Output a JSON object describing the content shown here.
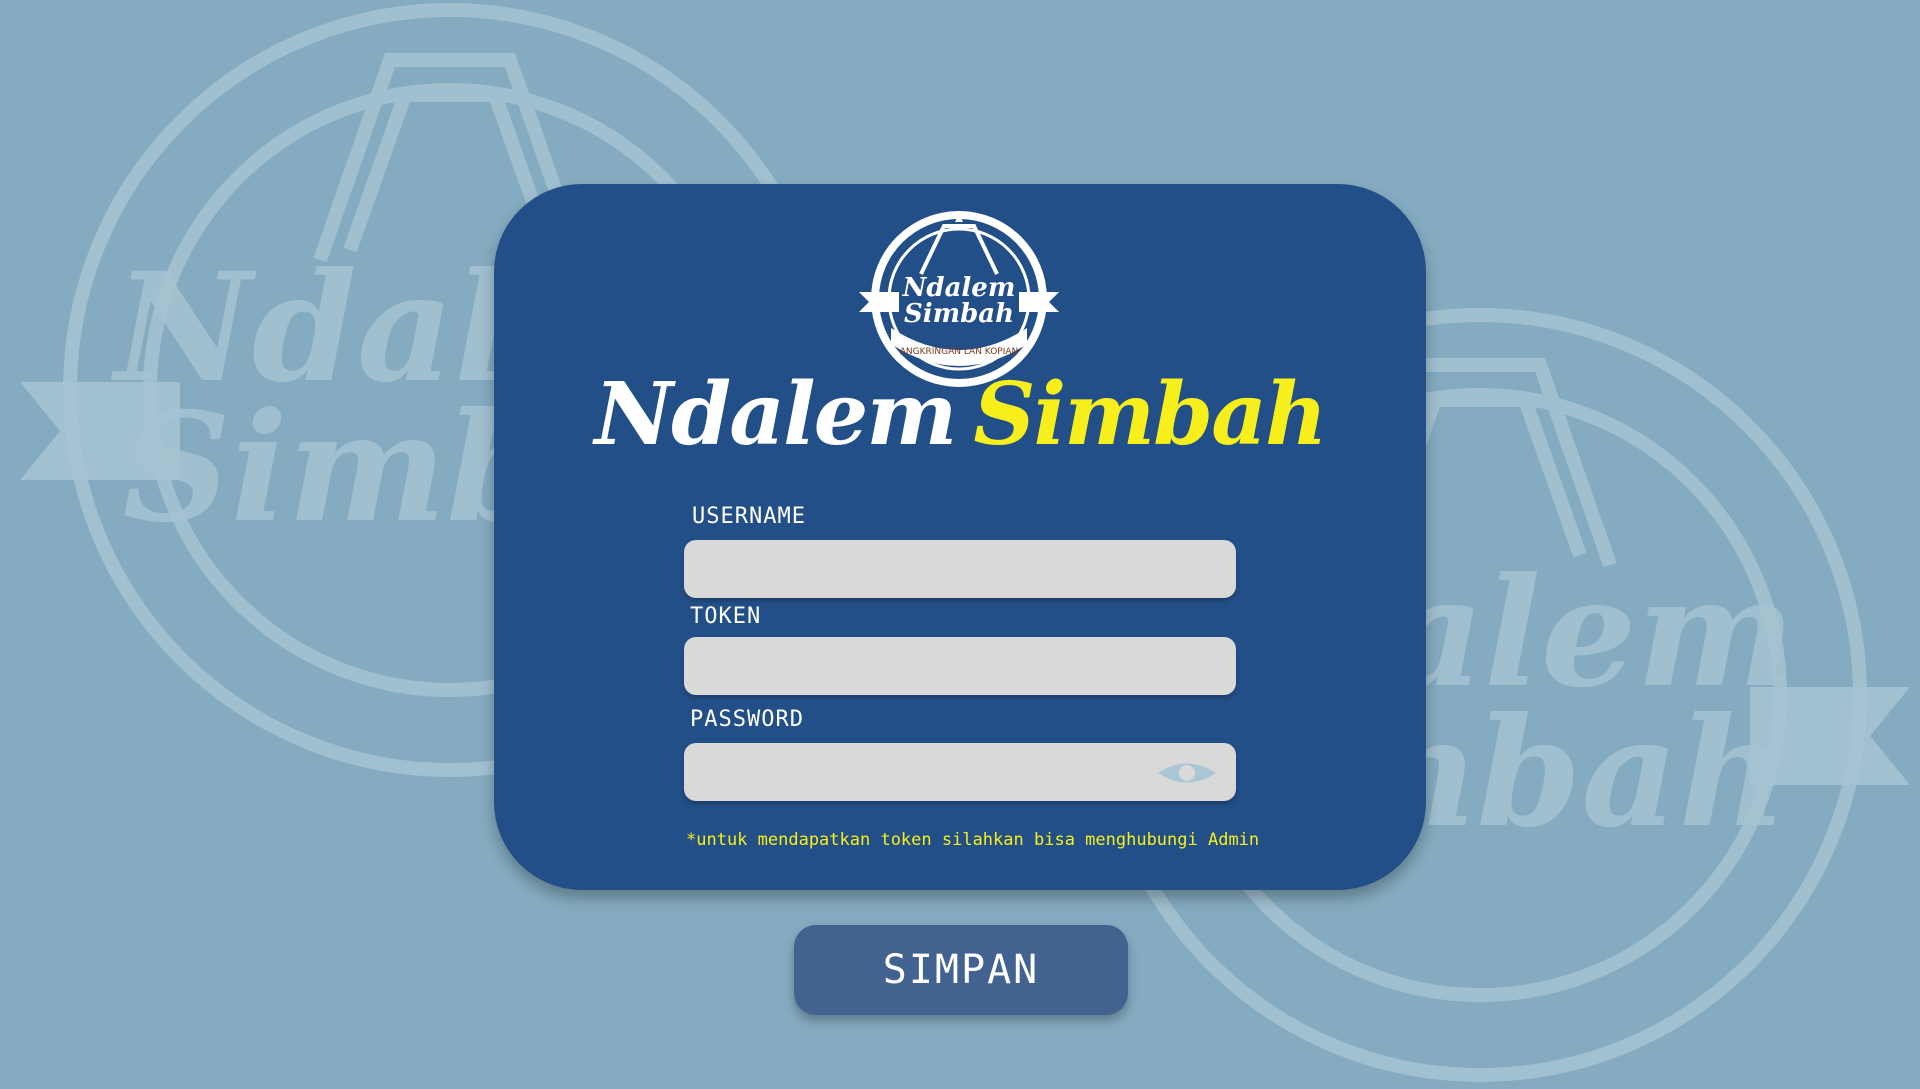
{
  "logo": {
    "line1": "Ndalem",
    "line2": "Simbah",
    "ribbon": "ANGKRINGAN LAN KOPIAN"
  },
  "brand": {
    "word1": "Ndalem",
    "word2": "Simbah"
  },
  "form": {
    "username_label": "USERNAME",
    "token_label": "TOKEN",
    "password_label": "PASSWORD",
    "note": "*untuk mendapatkan token silahkan bisa menghubungi Admin",
    "password_toggle_icon": "eye-icon"
  },
  "actions": {
    "save_label": "SIMPAN"
  },
  "colors": {
    "background": "#84abbf",
    "card": "#234f88",
    "accent_yellow": "#f6ef1c",
    "button": "#42628f",
    "input": "#d9d9d9"
  }
}
